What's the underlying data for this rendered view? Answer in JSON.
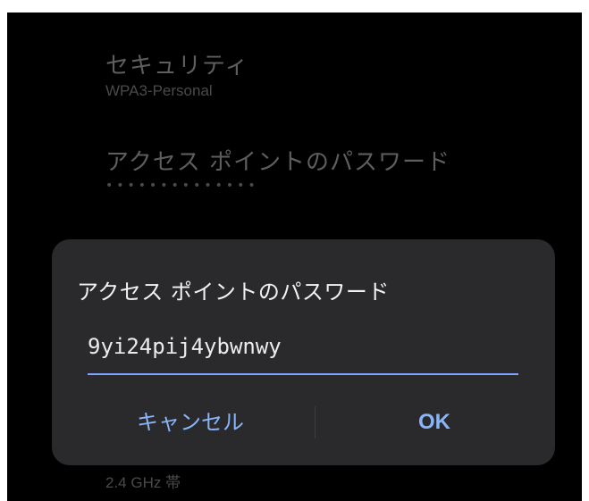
{
  "settings": {
    "security": {
      "title": "セキュリティ",
      "value": "WPA3-Personal"
    },
    "password": {
      "title": "アクセス ポイントのパスワード",
      "masked": "••••••••••••••"
    },
    "band": {
      "value": "2.4 GHz 帯"
    }
  },
  "dialog": {
    "title": "アクセス ポイントのパスワード",
    "input_value": "9yi24pij4ybwnwy",
    "cancel_label": "キャンセル",
    "ok_label": "OK",
    "accent_color": "#8ab4f8"
  }
}
